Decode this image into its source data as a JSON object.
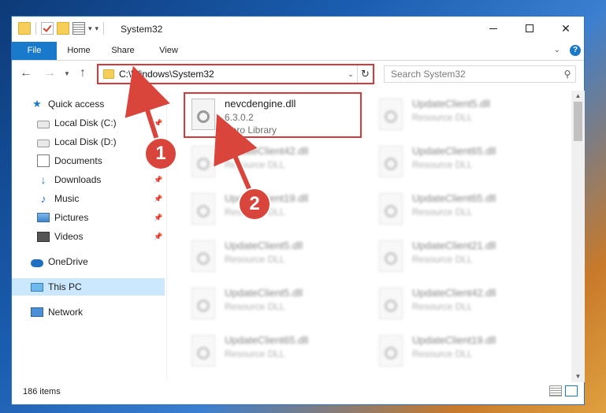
{
  "window": {
    "title": "System32",
    "controls": {
      "minimize": "minimize",
      "maximize": "maximize",
      "close": "✕"
    }
  },
  "ribbon": {
    "tabs": [
      "File",
      "Home",
      "Share",
      "View"
    ],
    "collapse": "⌄",
    "help": "?"
  },
  "address_bar": {
    "path": "C:\\Windows\\System32"
  },
  "search": {
    "placeholder": "Search System32"
  },
  "sidebar": {
    "items": [
      {
        "label": "Quick access",
        "icon": "star-icon",
        "pinned": false
      },
      {
        "label": "Local Disk (C:)",
        "icon": "disk-icon",
        "pinned": true
      },
      {
        "label": "Local Disk (D:)",
        "icon": "disk-icon",
        "pinned": false
      },
      {
        "label": "Documents",
        "icon": "documents-icon",
        "pinned": true
      },
      {
        "label": "Downloads",
        "icon": "download-icon",
        "pinned": true
      },
      {
        "label": "Music",
        "icon": "music-icon",
        "pinned": true
      },
      {
        "label": "Pictures",
        "icon": "pictures-icon",
        "pinned": true
      },
      {
        "label": "Videos",
        "icon": "videos-icon",
        "pinned": true
      },
      {
        "label": "OneDrive",
        "icon": "onedrive-icon",
        "pinned": false
      },
      {
        "label": "This PC",
        "icon": "this-pc-icon",
        "pinned": false,
        "selected": true
      },
      {
        "label": "Network",
        "icon": "network-icon",
        "pinned": false
      }
    ]
  },
  "files": {
    "highlighted": {
      "name": "nevcdengine.dll",
      "version": "6.3.0.2",
      "type": "Nero Library"
    },
    "left_column": [
      {
        "name": "UpdateClient42.dll",
        "type": "Resource DLL"
      },
      {
        "name": "UpdateClient19.dll",
        "type": "Resource DLL"
      },
      {
        "name": "UpdateClient5.dll",
        "type": "Resource DLL"
      },
      {
        "name": "UpdateClient5.dll",
        "type": "Resource DLL"
      },
      {
        "name": "UpdateClient65.dll",
        "type": "Resource DLL"
      }
    ],
    "right_column": [
      {
        "name": "UpdateClient5.dll",
        "type": "Resource DLL"
      },
      {
        "name": "UpdateClient65.dll",
        "type": "Resource DLL"
      },
      {
        "name": "UpdateClient65.dll",
        "type": "Resource DLL"
      },
      {
        "name": "UpdateClient21.dll",
        "type": "Resource DLL"
      },
      {
        "name": "UpdateClient42.dll",
        "type": "Resource DLL"
      },
      {
        "name": "UpdateClient19.dll",
        "type": "Resource DLL"
      }
    ]
  },
  "status_bar": {
    "item_count": "186 items"
  },
  "annotations": {
    "step1": "1",
    "step2": "2",
    "color": "#d9453b"
  }
}
